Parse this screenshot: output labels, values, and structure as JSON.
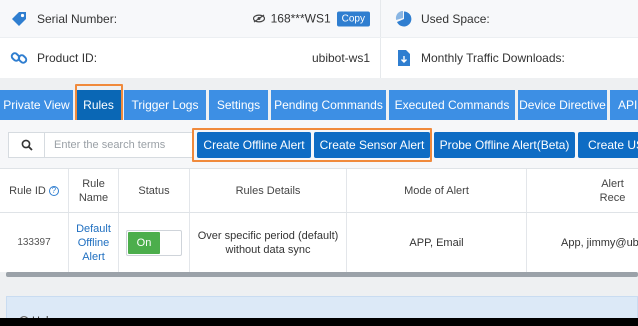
{
  "info": {
    "serial_label": "Serial Number:",
    "serial_value": "168***WS1",
    "copy_label": "Copy",
    "product_label": "Product ID:",
    "product_value": "ubibot-ws1",
    "used_space_label": "Used Space:",
    "traffic_label": "Monthly Traffic Downloads:"
  },
  "tabs": [
    {
      "label": "Private View"
    },
    {
      "label": "Rules"
    },
    {
      "label": "Trigger Logs"
    },
    {
      "label": "Settings"
    },
    {
      "label": "Pending Commands"
    },
    {
      "label": "Executed Commands"
    },
    {
      "label": "Device Directive"
    },
    {
      "label": "API K"
    }
  ],
  "active_tab": "Rules",
  "search": {
    "placeholder": "Enter the search terms"
  },
  "actions": {
    "offline": "Create Offline Alert",
    "sensor": "Create Sensor Alert",
    "probe": "Probe Offline Alert(Beta)",
    "create_us": "Create US"
  },
  "table": {
    "headers": {
      "rule_id": "Rule ID",
      "rule_name": [
        "Rule",
        "Name"
      ],
      "status": "Status",
      "details": "Rules Details",
      "mode": "Mode of Alert",
      "receiver": "Alert Rece"
    },
    "rows": [
      {
        "rule_id": "133397",
        "rule_name": [
          "Default",
          "Offline",
          "Alert"
        ],
        "status": "On",
        "details": [
          "Over specific period (default)",
          "without data sync"
        ],
        "mode": "APP, Email",
        "receiver": "App, jimmy@ub"
      }
    ]
  },
  "help": {
    "title": "Help:"
  },
  "colors": {
    "tab": "#3d8fe4",
    "active_tab": "#0a67b5",
    "action": "#0e6cc4",
    "highlight": "#f08a3c",
    "toggle_on": "#4cae4c"
  }
}
